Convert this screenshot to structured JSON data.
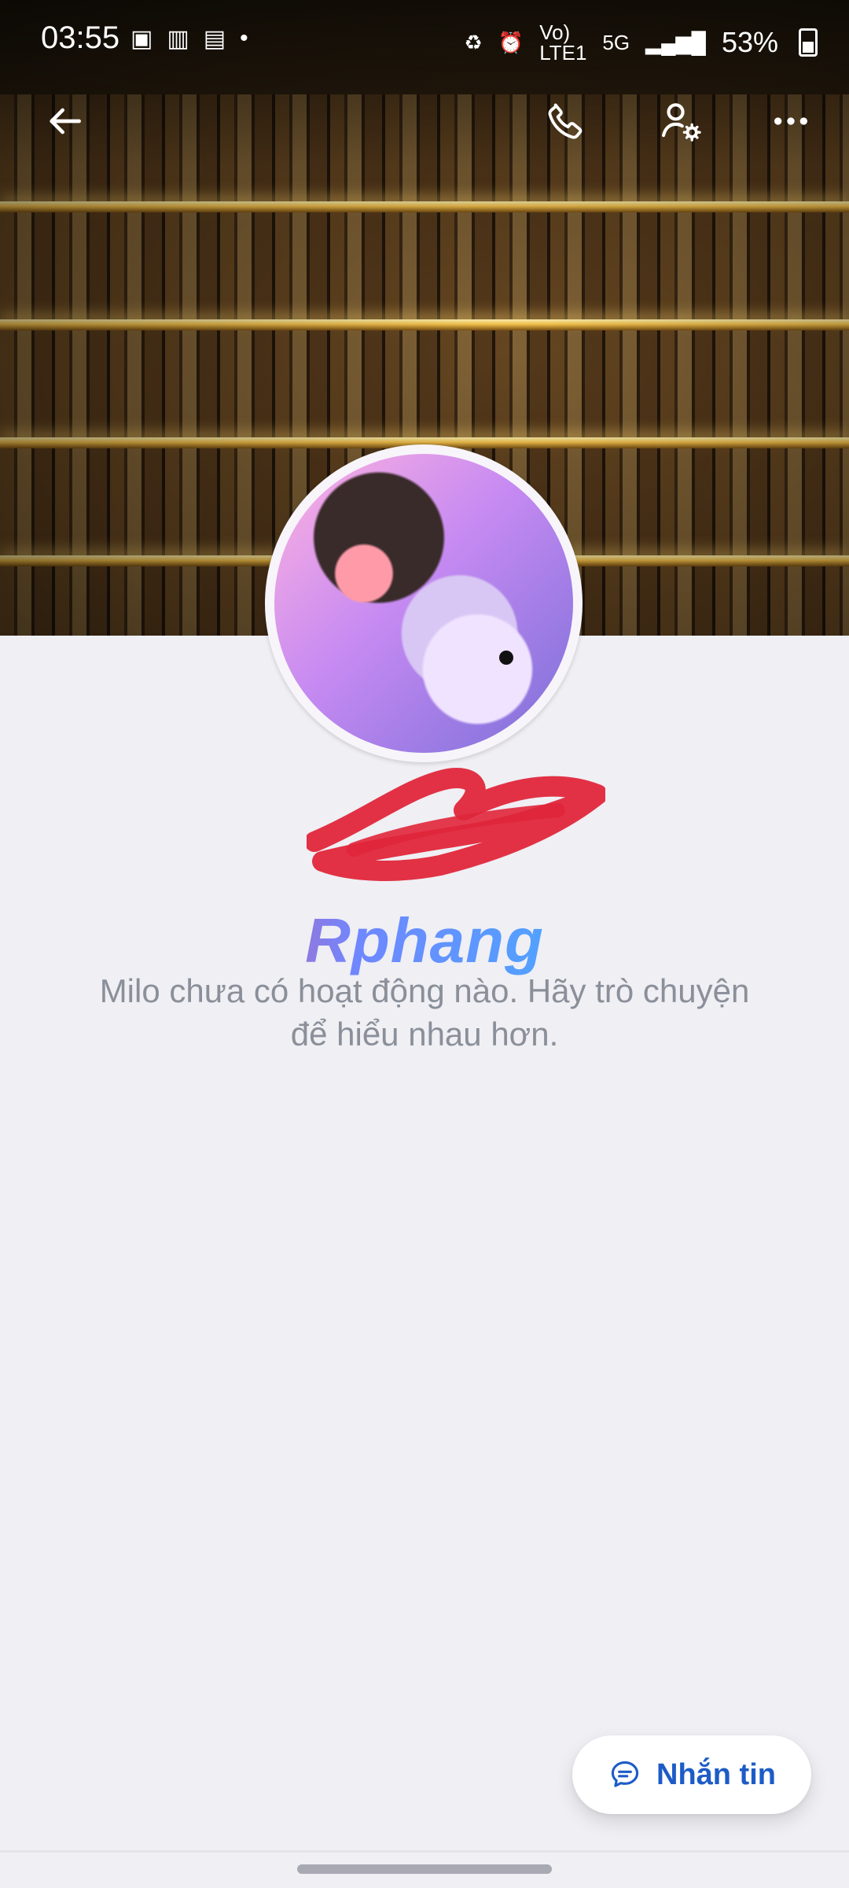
{
  "status_bar": {
    "time": "03:55",
    "network_label_top": "Vo)",
    "network_label_bottom": "LTE1",
    "network_type": "5G",
    "battery_percent": "53%"
  },
  "profile": {
    "watermark": "Rphang",
    "empty_state_text": "Milo chưa có hoạt động nào. Hãy trò chuyện để hiểu nhau hơn."
  },
  "actions": {
    "message_button_label": "Nhắn tin"
  },
  "icons": {
    "back": "arrow-left-icon",
    "call": "phone-icon",
    "profile_settings": "user-gear-icon",
    "more": "more-dots-icon",
    "chat": "chat-bubble-icon"
  },
  "colors": {
    "page_bg": "#efeff4",
    "accent_blue": "#1d5cc7",
    "text_gray": "#8a8f99",
    "redaction_red": "#e0263a"
  }
}
